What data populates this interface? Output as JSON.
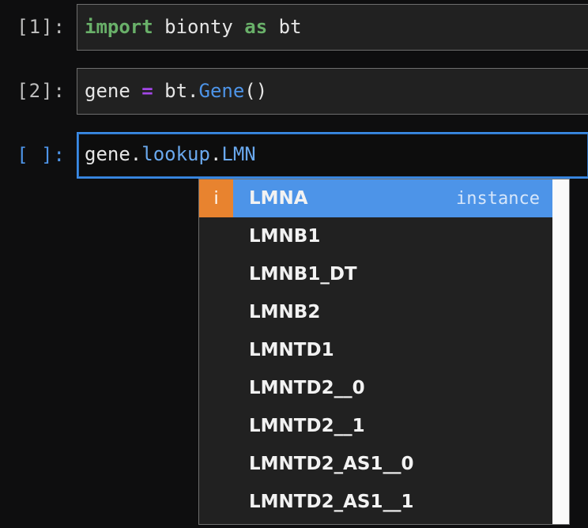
{
  "notebook": {
    "cells": [
      {
        "prompt": "[1]:",
        "active": false,
        "code_plain": "import bionty as bt",
        "tokens": [
          {
            "text": "import",
            "kind": "kw"
          },
          {
            "text": " bionty ",
            "kind": "plain"
          },
          {
            "text": "as",
            "kind": "kw"
          },
          {
            "text": " bt",
            "kind": "plain"
          }
        ]
      },
      {
        "prompt": "[2]:",
        "active": false,
        "code_plain": "gene = bt.Gene()",
        "tokens": [
          {
            "text": "gene ",
            "kind": "plain"
          },
          {
            "text": "=",
            "kind": "op"
          },
          {
            "text": " bt.",
            "kind": "plain"
          },
          {
            "text": "Gene",
            "kind": "cls"
          },
          {
            "text": "()",
            "kind": "plain"
          }
        ]
      },
      {
        "prompt": "[ ]:",
        "active": true,
        "code_plain": "gene.lookup.LMN",
        "tokens": [
          {
            "text": "gene",
            "kind": "plain"
          },
          {
            "text": ".",
            "kind": "plain"
          },
          {
            "text": "lookup",
            "kind": "attr"
          },
          {
            "text": ".",
            "kind": "plain"
          },
          {
            "text": "LMN",
            "kind": "attr"
          }
        ]
      }
    ]
  },
  "completer": {
    "badge_letter": "i",
    "items": [
      {
        "label": "LMNA",
        "type": "instance",
        "selected": true,
        "badge": "i"
      },
      {
        "label": "LMNB1",
        "type": "",
        "selected": false,
        "badge": ""
      },
      {
        "label": "LMNB1_DT",
        "type": "",
        "selected": false,
        "badge": ""
      },
      {
        "label": "LMNB2",
        "type": "",
        "selected": false,
        "badge": ""
      },
      {
        "label": "LMNTD1",
        "type": "",
        "selected": false,
        "badge": ""
      },
      {
        "label": "LMNTD2__0",
        "type": "",
        "selected": false,
        "badge": ""
      },
      {
        "label": "LMNTD2__1",
        "type": "",
        "selected": false,
        "badge": ""
      },
      {
        "label": "LMNTD2_AS1__0",
        "type": "",
        "selected": false,
        "badge": ""
      },
      {
        "label": "LMNTD2_AS1__1",
        "type": "",
        "selected": false,
        "badge": ""
      }
    ]
  },
  "colors": {
    "page_background": "#0e0e0f",
    "cell_background": "#212121",
    "cell_border": "#6e6e6e",
    "active_cell_border": "#3b8ae5",
    "selection_blue": "#4d94e8",
    "badge_orange": "#e8832f",
    "keyword_green": "#69b069",
    "operator_purple": "#a347e8",
    "attribute_blue": "#6aa9ee",
    "scrollbar_track": "#fafafa"
  }
}
